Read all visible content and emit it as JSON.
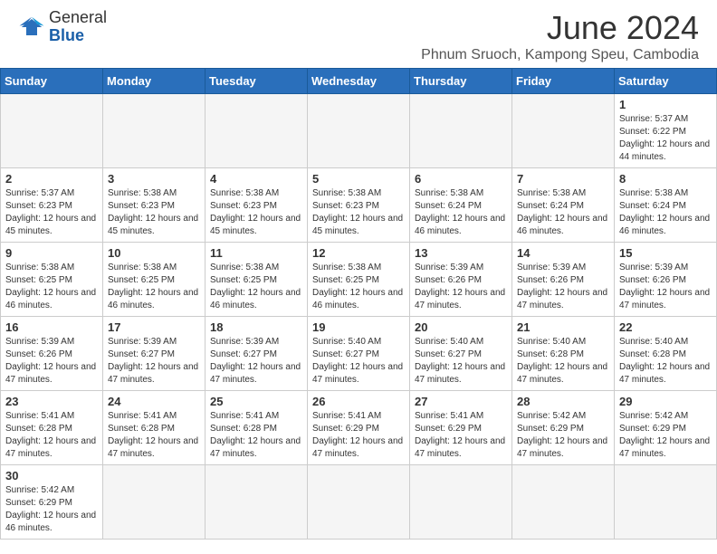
{
  "header": {
    "logo_text_general": "General",
    "logo_text_blue": "Blue",
    "main_title": "June 2024",
    "subtitle": "Phnum Sruoch, Kampong Speu, Cambodia"
  },
  "weekdays": [
    "Sunday",
    "Monday",
    "Tuesday",
    "Wednesday",
    "Thursday",
    "Friday",
    "Saturday"
  ],
  "days": [
    {
      "date": "",
      "empty": true
    },
    {
      "date": "",
      "empty": true
    },
    {
      "date": "",
      "empty": true
    },
    {
      "date": "",
      "empty": true
    },
    {
      "date": "",
      "empty": true
    },
    {
      "date": "",
      "empty": true
    },
    {
      "date": "1",
      "sunrise": "5:37 AM",
      "sunset": "6:22 PM",
      "daylight": "12 hours and 44 minutes."
    },
    {
      "date": "2",
      "sunrise": "5:37 AM",
      "sunset": "6:23 PM",
      "daylight": "12 hours and 45 minutes."
    },
    {
      "date": "3",
      "sunrise": "5:38 AM",
      "sunset": "6:23 PM",
      "daylight": "12 hours and 45 minutes."
    },
    {
      "date": "4",
      "sunrise": "5:38 AM",
      "sunset": "6:23 PM",
      "daylight": "12 hours and 45 minutes."
    },
    {
      "date": "5",
      "sunrise": "5:38 AM",
      "sunset": "6:23 PM",
      "daylight": "12 hours and 45 minutes."
    },
    {
      "date": "6",
      "sunrise": "5:38 AM",
      "sunset": "6:24 PM",
      "daylight": "12 hours and 46 minutes."
    },
    {
      "date": "7",
      "sunrise": "5:38 AM",
      "sunset": "6:24 PM",
      "daylight": "12 hours and 46 minutes."
    },
    {
      "date": "8",
      "sunrise": "5:38 AM",
      "sunset": "6:24 PM",
      "daylight": "12 hours and 46 minutes."
    },
    {
      "date": "9",
      "sunrise": "5:38 AM",
      "sunset": "6:25 PM",
      "daylight": "12 hours and 46 minutes."
    },
    {
      "date": "10",
      "sunrise": "5:38 AM",
      "sunset": "6:25 PM",
      "daylight": "12 hours and 46 minutes."
    },
    {
      "date": "11",
      "sunrise": "5:38 AM",
      "sunset": "6:25 PM",
      "daylight": "12 hours and 46 minutes."
    },
    {
      "date": "12",
      "sunrise": "5:38 AM",
      "sunset": "6:25 PM",
      "daylight": "12 hours and 46 minutes."
    },
    {
      "date": "13",
      "sunrise": "5:39 AM",
      "sunset": "6:26 PM",
      "daylight": "12 hours and 47 minutes."
    },
    {
      "date": "14",
      "sunrise": "5:39 AM",
      "sunset": "6:26 PM",
      "daylight": "12 hours and 47 minutes."
    },
    {
      "date": "15",
      "sunrise": "5:39 AM",
      "sunset": "6:26 PM",
      "daylight": "12 hours and 47 minutes."
    },
    {
      "date": "16",
      "sunrise": "5:39 AM",
      "sunset": "6:26 PM",
      "daylight": "12 hours and 47 minutes."
    },
    {
      "date": "17",
      "sunrise": "5:39 AM",
      "sunset": "6:27 PM",
      "daylight": "12 hours and 47 minutes."
    },
    {
      "date": "18",
      "sunrise": "5:39 AM",
      "sunset": "6:27 PM",
      "daylight": "12 hours and 47 minutes."
    },
    {
      "date": "19",
      "sunrise": "5:40 AM",
      "sunset": "6:27 PM",
      "daylight": "12 hours and 47 minutes."
    },
    {
      "date": "20",
      "sunrise": "5:40 AM",
      "sunset": "6:27 PM",
      "daylight": "12 hours and 47 minutes."
    },
    {
      "date": "21",
      "sunrise": "5:40 AM",
      "sunset": "6:28 PM",
      "daylight": "12 hours and 47 minutes."
    },
    {
      "date": "22",
      "sunrise": "5:40 AM",
      "sunset": "6:28 PM",
      "daylight": "12 hours and 47 minutes."
    },
    {
      "date": "23",
      "sunrise": "5:41 AM",
      "sunset": "6:28 PM",
      "daylight": "12 hours and 47 minutes."
    },
    {
      "date": "24",
      "sunrise": "5:41 AM",
      "sunset": "6:28 PM",
      "daylight": "12 hours and 47 minutes."
    },
    {
      "date": "25",
      "sunrise": "5:41 AM",
      "sunset": "6:28 PM",
      "daylight": "12 hours and 47 minutes."
    },
    {
      "date": "26",
      "sunrise": "5:41 AM",
      "sunset": "6:29 PM",
      "daylight": "12 hours and 47 minutes."
    },
    {
      "date": "27",
      "sunrise": "5:41 AM",
      "sunset": "6:29 PM",
      "daylight": "12 hours and 47 minutes."
    },
    {
      "date": "28",
      "sunrise": "5:42 AM",
      "sunset": "6:29 PM",
      "daylight": "12 hours and 47 minutes."
    },
    {
      "date": "29",
      "sunrise": "5:42 AM",
      "sunset": "6:29 PM",
      "daylight": "12 hours and 47 minutes."
    },
    {
      "date": "30",
      "sunrise": "5:42 AM",
      "sunset": "6:29 PM",
      "daylight": "12 hours and 46 minutes."
    }
  ]
}
